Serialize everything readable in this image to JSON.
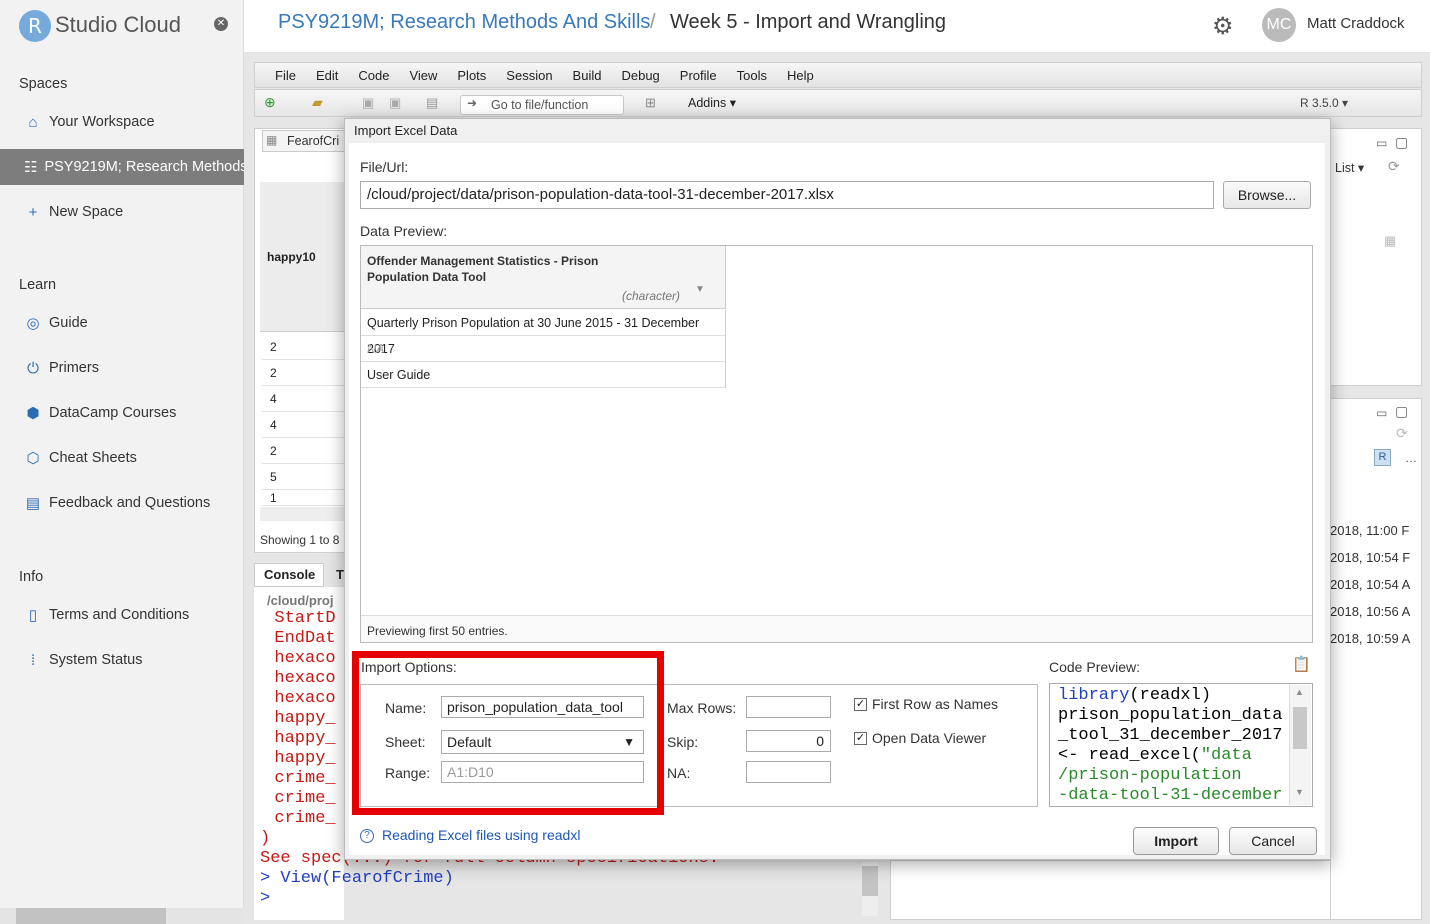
{
  "sidebar": {
    "brand_letter": "R",
    "brand_text": "Studio Cloud",
    "sections": {
      "spaces": "Spaces",
      "learn": "Learn",
      "info": "Info"
    },
    "spaces_items": [
      "Your Workspace",
      "PSY9219M; Research Methods",
      "New Space"
    ],
    "learn_items": [
      "Guide",
      "Primers",
      "DataCamp Courses",
      "Cheat Sheets",
      "Feedback and Questions"
    ],
    "info_items": [
      "Terms and Conditions",
      "System Status"
    ]
  },
  "header": {
    "space": "PSY9219M; Research Methods And Skills",
    "separator": "/",
    "project": "Week 5 - Import and Wrangling",
    "avatar_initials": "MC",
    "user": "Matt Craddock"
  },
  "ide": {
    "menu": [
      "File",
      "Edit",
      "Code",
      "View",
      "Plots",
      "Session",
      "Build",
      "Debug",
      "Profile",
      "Tools",
      "Help"
    ],
    "goto_placeholder": "Go to file/function",
    "addins": "Addins",
    "r_version": "R 3.5.0",
    "data_tab": "FearofCri",
    "column_header": "happy10",
    "rows": [
      "2",
      "2",
      "4",
      "4",
      "2",
      "5",
      "1"
    ],
    "showing": "Showing 1 to 8",
    "console_tab": "Console",
    "console_tab2": "T",
    "console_path": "/cloud/proj",
    "console_lines": [
      "  StartD",
      "  EndDat",
      "  hexaco",
      "  hexaco",
      "  hexaco",
      "  happy_",
      "  happy_",
      "  happy_",
      "  crime_",
      "  crime_",
      "  crime_",
      ")",
      "See spec(...) for full column specifications.",
      "> View(FearofCrime)",
      "> "
    ],
    "right_list": "List",
    "dates": [
      "2018, 11:00 F",
      "2018, 10:54 F",
      "2018, 10:54 A",
      "2018, 10:56 A",
      "2018, 10:59 A"
    ]
  },
  "dialog": {
    "title": "Import Excel Data",
    "file_label": "File/Url:",
    "file_value": "/cloud/project/data/prison-population-data-tool-31-december-2017.xlsx",
    "browse": "Browse...",
    "preview_label": "Data Preview:",
    "preview_header": "Offender Management Statistics - Prison Population Data Tool",
    "preview_type": "(character)",
    "preview_rows": [
      "Quarterly Prison Population at 30 June 2015 - 31 December 2017",
      "NA",
      "User Guide"
    ],
    "preview_footer": "Previewing first 50 entries.",
    "options_label": "Import Options:",
    "name_label": "Name:",
    "name_value": "prison_population_data_tool",
    "sheet_label": "Sheet:",
    "sheet_value": "Default",
    "range_label": "Range:",
    "range_placeholder": "A1:D10",
    "maxrows_label": "Max Rows:",
    "maxrows_value": "",
    "skip_label": "Skip:",
    "skip_value": "0",
    "na_label": "NA:",
    "na_value": "",
    "first_row_label": "First Row as Names",
    "first_row_checked": true,
    "open_viewer_label": "Open Data Viewer",
    "open_viewer_checked": true,
    "code_label": "Code Preview:",
    "code_lines": [
      {
        "parts": [
          [
            "kw",
            "library"
          ],
          [
            "",
            "(readxl)"
          ]
        ]
      },
      {
        "parts": [
          [
            "",
            "prison_population_data"
          ]
        ]
      },
      {
        "parts": [
          [
            "",
            "_tool_31_december_2017"
          ]
        ]
      },
      {
        "parts": [
          [
            "",
            "<- read_excel("
          ],
          [
            "str",
            "\"data"
          ]
        ]
      },
      {
        "parts": [
          [
            "str",
            "/prison-population"
          ]
        ]
      },
      {
        "parts": [
          [
            "str",
            "-data-tool-31-december"
          ]
        ]
      }
    ],
    "help_link": "Reading Excel files using readxl",
    "import_btn": "Import",
    "cancel_btn": "Cancel",
    "highlight_color": "#e60000"
  }
}
